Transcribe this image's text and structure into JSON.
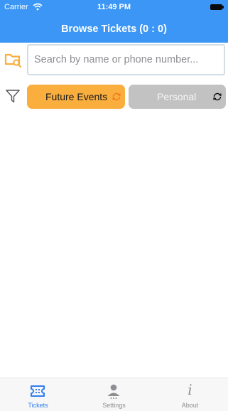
{
  "status_bar": {
    "carrier": "Carrier",
    "time": "11:49 PM"
  },
  "header": {
    "title": "Browse Tickets (0 : 0)"
  },
  "search": {
    "placeholder": "Search by name or phone number...",
    "value": ""
  },
  "filters": {
    "future_events": {
      "label": "Future Events",
      "icon": "refresh-icon",
      "color": "#f9ae3d"
    },
    "personal": {
      "label": "Personal",
      "icon": "refresh-icon",
      "color": "#c2c2c2"
    }
  },
  "tabbar": {
    "tickets": {
      "label": "Tickets",
      "icon": "ticket-icon",
      "active": true
    },
    "settings": {
      "label": "Settings",
      "icon": "person-icon",
      "active": false
    },
    "about": {
      "label": "About",
      "icon": "info-icon",
      "glyph": "i",
      "active": false
    }
  },
  "colors": {
    "header": "#3b96f5",
    "accent": "#2f7ef0",
    "folder": "#f9ae3d"
  }
}
